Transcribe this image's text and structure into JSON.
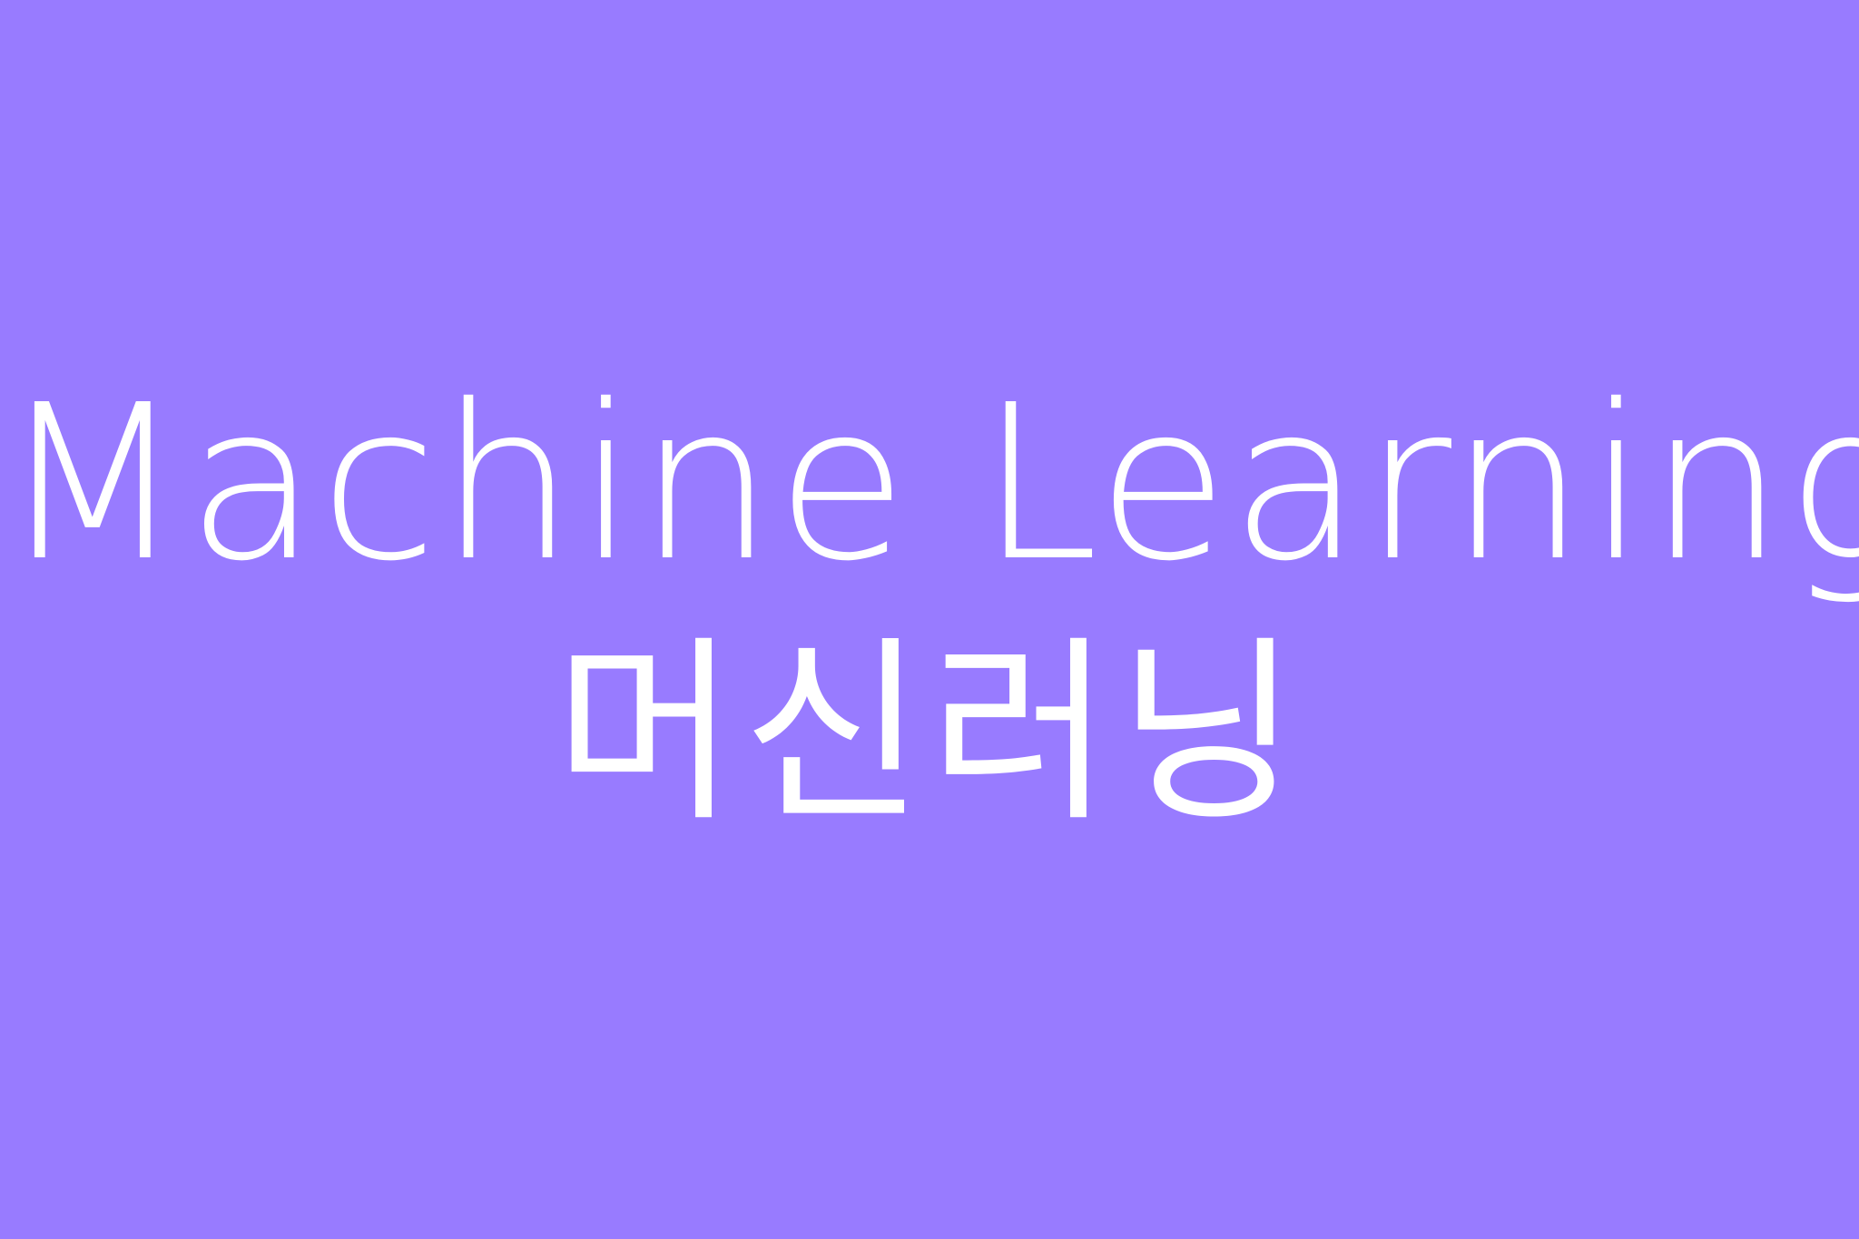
{
  "background_color": "#987bff",
  "text_color": "#ffffff",
  "title": {
    "english": "Machine Learning",
    "korean": "머신러닝"
  }
}
